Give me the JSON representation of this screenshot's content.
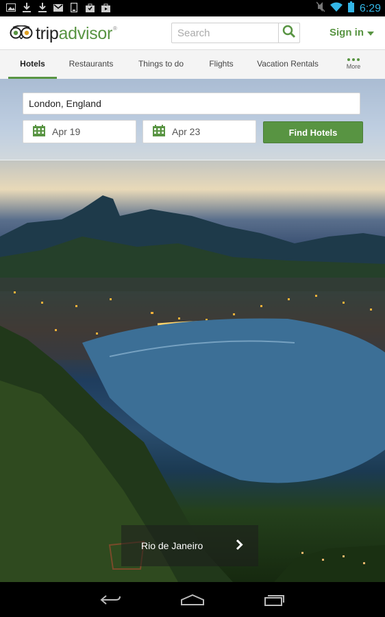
{
  "status_bar": {
    "left_icons": [
      "image-icon",
      "download-icon",
      "download-icon",
      "gmail-icon",
      "phone-icon",
      "bag-icon",
      "bag-icon"
    ],
    "right_icons": [
      "mute-icon",
      "wifi-icon",
      "battery-icon"
    ],
    "time": "6:29"
  },
  "app_bar": {
    "logo_trip": "trip",
    "logo_advisor": "advisor",
    "logo_reg": "®",
    "search_placeholder": "Search",
    "signin_label": "Sign in"
  },
  "tabs": [
    {
      "label": "Hotels",
      "active": true
    },
    {
      "label": "Restaurants",
      "active": false
    },
    {
      "label": "Things to do",
      "active": false
    },
    {
      "label": "Flights",
      "active": false
    },
    {
      "label": "Vacation Rentals",
      "active": false
    },
    {
      "label": "More",
      "active": false
    }
  ],
  "search_form": {
    "location_value": "London, England",
    "checkin_date": "Apr 19",
    "checkout_date": "Apr 23",
    "find_button_label": "Find Hotels"
  },
  "hero": {
    "caption": "Rio de Janeiro"
  },
  "colors": {
    "brand_green": "#589442",
    "status_time": "#33b5e5"
  }
}
